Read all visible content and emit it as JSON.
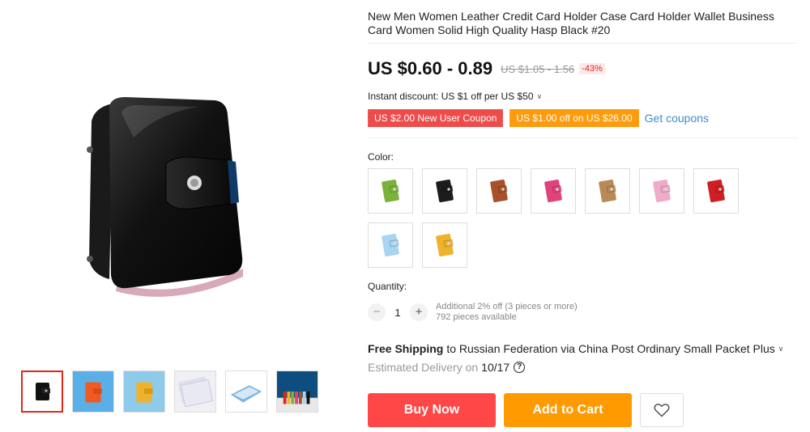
{
  "product": {
    "title": "New Men Women Leather Credit Card Holder Case Card Holder Wallet Business Card Women Solid High Quality Hasp Black #20"
  },
  "gallery": {
    "main_image": "black-leather-card-holder",
    "thumbnails": [
      {
        "name": "thumb-black-holder",
        "active": true
      },
      {
        "name": "thumb-orange-holder",
        "active": false
      },
      {
        "name": "thumb-yellow-holder",
        "active": false
      },
      {
        "name": "thumb-card-sleeves",
        "active": false
      },
      {
        "name": "thumb-holder-open",
        "active": false
      },
      {
        "name": "thumb-holder-colors",
        "active": false
      }
    ]
  },
  "price": {
    "current": "US $0.60 - 0.89",
    "original": "US $1.05 - 1.56",
    "discount": "-43%"
  },
  "instant_discount": {
    "text": "Instant discount: US $1 off per US $50",
    "chevron": "chevron-down-icon"
  },
  "coupons": {
    "new_user": "US $2.00 New User Coupon",
    "store": "US $1.00 off on US $26.00",
    "get_coupons": "Get coupons"
  },
  "color": {
    "label": "Color:",
    "options": [
      {
        "name": "green",
        "color": "#7bb33a"
      },
      {
        "name": "black",
        "color": "#1c1c1c"
      },
      {
        "name": "brown",
        "color": "#a8502a"
      },
      {
        "name": "rose",
        "color": "#e0437a"
      },
      {
        "name": "tan",
        "color": "#b98a57"
      },
      {
        "name": "pink",
        "color": "#f0aacb"
      },
      {
        "name": "red",
        "color": "#cf1f24"
      },
      {
        "name": "light-blue",
        "color": "#a8d5f2"
      },
      {
        "name": "yellow",
        "color": "#f0b22c"
      }
    ]
  },
  "quantity": {
    "label": "Quantity:",
    "minus": "−",
    "value": "1",
    "plus": "+",
    "note_line1": "Additional 2% off (3 pieces or more)",
    "note_line2": "792 pieces available"
  },
  "shipping": {
    "bold": "Free Shipping",
    "rest": "to Russian Federation via China Post Ordinary Small Packet Plus",
    "chevron": "chevron-down-icon"
  },
  "delivery": {
    "label": "Estimated Delivery on",
    "date": "10/17",
    "help_icon": "?"
  },
  "actions": {
    "buy_now": "Buy Now",
    "add_to_cart": "Add to Cart",
    "wishlist_icon": "heart-icon"
  },
  "colors": {
    "accent_red": "#ff4747",
    "accent_orange": "#ff9a00",
    "link_blue": "#3d8bd1"
  }
}
